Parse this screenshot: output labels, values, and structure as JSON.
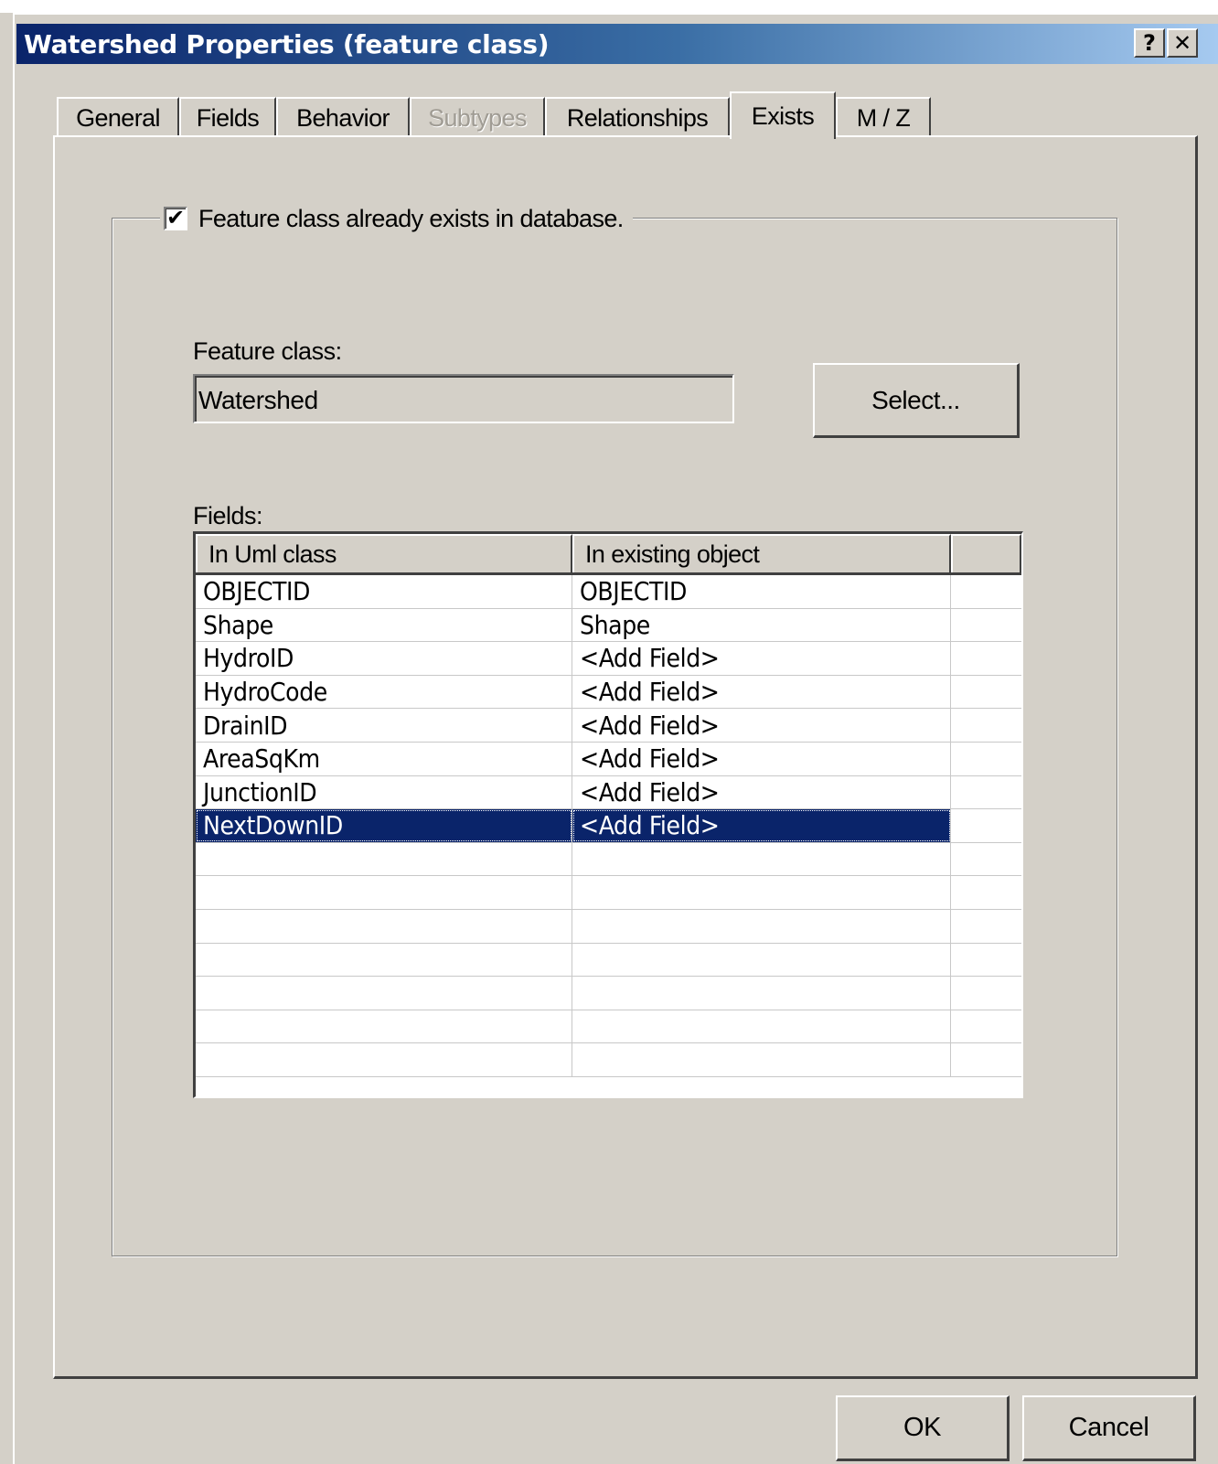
{
  "window": {
    "title": "Watershed Properties (feature class)",
    "help_label": "?",
    "close_label": "✕"
  },
  "tabs": [
    {
      "label": "General",
      "state": "normal"
    },
    {
      "label": "Fields",
      "state": "normal"
    },
    {
      "label": "Behavior",
      "state": "normal"
    },
    {
      "label": "Subtypes",
      "state": "disabled"
    },
    {
      "label": "Relationships",
      "state": "normal"
    },
    {
      "label": "Exists",
      "state": "active"
    },
    {
      "label": "M / Z",
      "state": "normal"
    }
  ],
  "exists": {
    "checkbox_label": "Feature class already exists in database.",
    "checked": true,
    "check_mark": "✔",
    "feature_class_label": "Feature class:",
    "feature_class_value": "Watershed",
    "select_button": "Select...",
    "fields_label": "Fields:"
  },
  "grid": {
    "columns": [
      "In Uml class",
      "In existing object",
      ""
    ],
    "rows": [
      {
        "uml": "OBJECTID",
        "existing": "OBJECTID"
      },
      {
        "uml": "Shape",
        "existing": "Shape"
      },
      {
        "uml": "HydroID",
        "existing": "<Add Field>"
      },
      {
        "uml": "HydroCode",
        "existing": "<Add Field>"
      },
      {
        "uml": "DrainID",
        "existing": "<Add Field>"
      },
      {
        "uml": "AreaSqKm",
        "existing": "<Add Field>"
      },
      {
        "uml": "JunctionID",
        "existing": "<Add Field>"
      },
      {
        "uml": "NextDownID",
        "existing": "<Add Field>",
        "selected": true
      }
    ],
    "empty_rows": 7
  },
  "buttons": {
    "ok": "OK",
    "cancel": "Cancel"
  }
}
